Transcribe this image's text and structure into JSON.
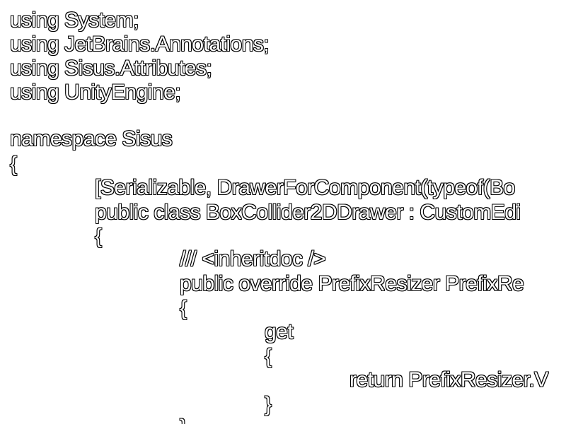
{
  "code": {
    "lines": [
      "using System;",
      "using JetBrains.Annotations;",
      "using Sisus.Attributes;",
      "using UnityEngine;",
      "",
      "namespace Sisus",
      "{",
      "[Serializable, DrawerForComponent(typeof(Bo",
      "public class BoxCollider2DDrawer : CustomEdi",
      "{",
      "/// <inheritdoc />",
      "public override PrefixResizer PrefixRe",
      "{",
      "get",
      "{",
      "return PrefixResizer.V",
      "}",
      "}"
    ]
  }
}
